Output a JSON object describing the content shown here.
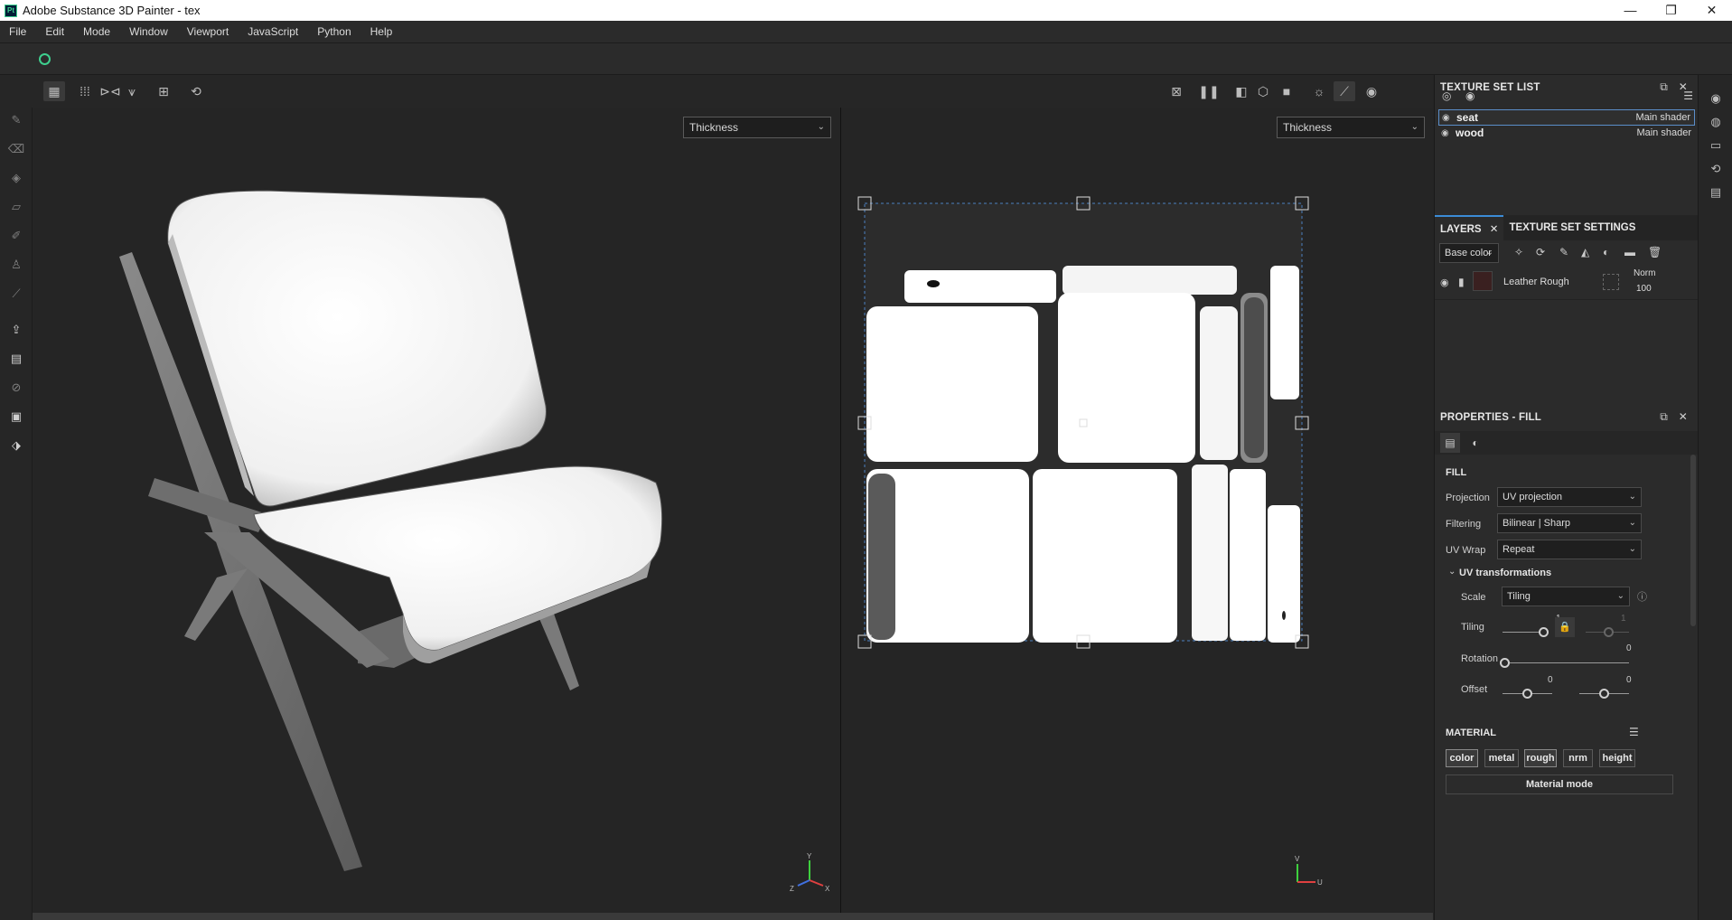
{
  "window": {
    "title": "Adobe Substance 3D Painter - tex",
    "logo": "Pt",
    "minimize": "—",
    "maximize": "❐",
    "close": "✕"
  },
  "menu": [
    "File",
    "Edit",
    "Mode",
    "Window",
    "Viewport",
    "JavaScript",
    "Python",
    "Help"
  ],
  "viewports": {
    "left_channel": "Thickness",
    "right_channel": "Thickness",
    "axis_left": {
      "y": "Y",
      "x": "X",
      "z": "Z"
    },
    "axis_right": {
      "y": "V",
      "x": "U"
    }
  },
  "texture_set_list": {
    "title": "TEXTURE SET LIST",
    "items": [
      {
        "name": "seat",
        "shader": "Main shader",
        "selected": true
      },
      {
        "name": "wood",
        "shader": "Main shader",
        "selected": false
      }
    ]
  },
  "layers": {
    "tabs": [
      "LAYERS",
      "TEXTURE SET SETTINGS"
    ],
    "channel": "Base color",
    "layer": {
      "name": "Leather Rough",
      "blend": "Norm",
      "opacity": "100"
    }
  },
  "properties": {
    "title": "PROPERTIES - FILL",
    "section": "FILL",
    "projection": {
      "label": "Projection",
      "value": "UV projection"
    },
    "filtering": {
      "label": "Filtering",
      "value": "Bilinear | Sharp"
    },
    "uvwrap": {
      "label": "UV Wrap",
      "value": "Repeat"
    },
    "uvtransform": {
      "title": "UV transformations",
      "scale": {
        "label": "Scale",
        "value": "Tiling"
      },
      "tiling": {
        "label": "Tiling",
        "value_u": "1",
        "value_v": "1"
      },
      "rotation": {
        "label": "Rotation",
        "value": "0"
      },
      "offset": {
        "label": "Offset",
        "value_u": "0",
        "value_v": "0"
      }
    },
    "material": {
      "title": "MATERIAL",
      "channels": [
        {
          "label": "color",
          "on": true
        },
        {
          "label": "metal",
          "on": false
        },
        {
          "label": "rough",
          "on": true
        },
        {
          "label": "nrm",
          "on": false
        },
        {
          "label": "height",
          "on": false
        }
      ],
      "mode_label": "Material mode"
    }
  }
}
